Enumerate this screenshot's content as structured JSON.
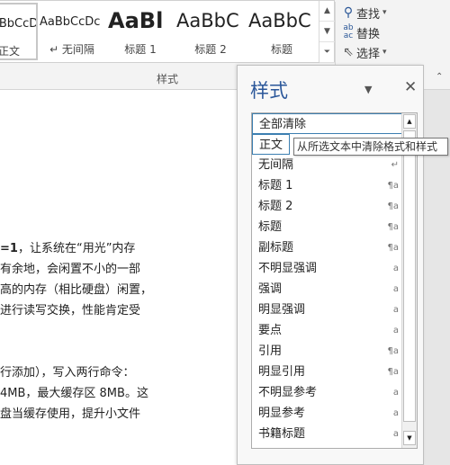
{
  "gallery": {
    "items": [
      {
        "preview": "AaBbCcDc",
        "caption": "正文"
      },
      {
        "preview": "AaBbCcDc",
        "caption": "↵ 无间隔"
      },
      {
        "preview": "AaBl",
        "caption": "标题 1"
      },
      {
        "preview": "AaBbC",
        "caption": "标题 2"
      },
      {
        "preview": "AaBbC",
        "caption": "标题"
      }
    ],
    "group_label": "样式"
  },
  "editing": {
    "find": "查找",
    "replace": "替换",
    "select": "选择",
    "find_icon": "search-icon",
    "replace_icon": "replace-icon",
    "select_icon": "cursor-icon"
  },
  "document": {
    "lines": [
      {
        "bold": "=1",
        "text": "，让系统在“用光”内存"
      },
      {
        "bold": "",
        "text": "有余地，会闲置不小的一部"
      },
      {
        "bold": "",
        "text": "高的内存（相比硬盘）闲置，"
      },
      {
        "bold": "",
        "text": "进行读写交换，性能肯定受"
      },
      {
        "bold": "",
        "text": "行添加），写入两行命令："
      },
      {
        "bold": "",
        "text": "4MB，最大缓存区 8MB。这"
      },
      {
        "bold": "",
        "text": "盘当缓存使用，提升小文件"
      }
    ]
  },
  "pane": {
    "title": "样式",
    "styles": [
      {
        "name": "全部清除",
        "marker": ""
      },
      {
        "name": "正文",
        "marker": "↵"
      },
      {
        "name": "无间隔",
        "marker": "↵"
      },
      {
        "name": "标题 1",
        "marker": "¶a"
      },
      {
        "name": "标题 2",
        "marker": "¶a"
      },
      {
        "name": "标题",
        "marker": "¶a"
      },
      {
        "name": "副标题",
        "marker": "¶a"
      },
      {
        "name": "不明显强调",
        "marker": "a"
      },
      {
        "name": "强调",
        "marker": "a"
      },
      {
        "name": "明显强调",
        "marker": "a"
      },
      {
        "name": "要点",
        "marker": "a"
      },
      {
        "name": "引用",
        "marker": "¶a"
      },
      {
        "name": "明显引用",
        "marker": "¶a"
      },
      {
        "name": "不明显参考",
        "marker": "a"
      },
      {
        "name": "明显参考",
        "marker": "a"
      },
      {
        "name": "书籍标题",
        "marker": "a"
      }
    ]
  },
  "tooltip": "从所选文本中清除格式和样式",
  "colors": {
    "accent": "#2b579a",
    "selection_border": "#3c7fb1"
  }
}
